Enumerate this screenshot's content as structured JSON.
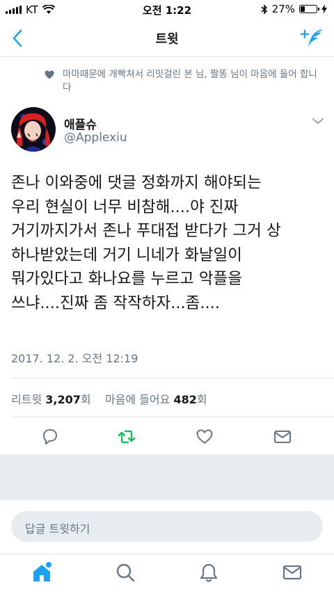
{
  "status_bar": {
    "carrier": "KT",
    "time": "오전 1:22",
    "battery": "27%",
    "battery_fraction": 0.27
  },
  "nav": {
    "title": "트윗"
  },
  "social_context": {
    "text": "마마때문에 개빡쳐서 리밋걸린 본 님, 짤똥 님이 마음에 들어 합니다"
  },
  "author": {
    "name": "애플슈",
    "handle": "@Applexiu"
  },
  "tweet": {
    "text": "존나 이와중에 댓글 정화까지 해야되는\n우리 현실이 너무 비참해....야 진짜\n거기까지가서 존나 푸대접 받다가 그거 상\n하나받았는데 거기 니네가 화날일이\n뭐가있다고 화나요를 누르고 악플을\n쓰냐....진짜 좀 작작하자...좀....",
    "timestamp": "2017. 12. 2. 오전 12:19"
  },
  "stats": {
    "retweet_label": "리트윗",
    "retweet_count": "3,207",
    "retweet_unit": "회",
    "like_label": "마음에 들어요",
    "like_count": "482",
    "like_unit": "회"
  },
  "reply": {
    "placeholder": "답글 트윗하기"
  },
  "colors": {
    "accent": "#1da1f2",
    "retweet_green": "#17bf63",
    "muted": "#657786"
  }
}
